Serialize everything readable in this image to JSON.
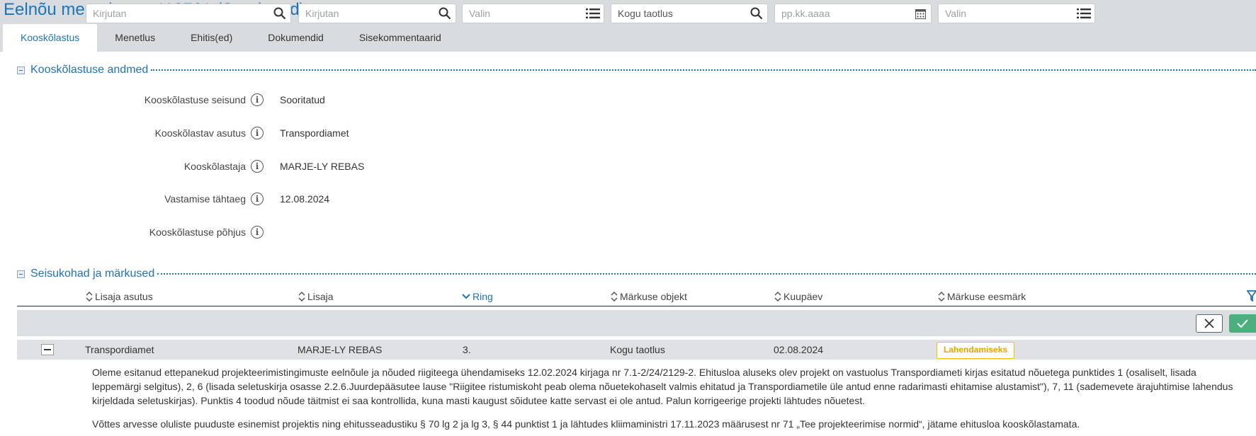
{
  "page": {
    "title": "Eelnõu menetlus nr 419761 (Sooritatud)"
  },
  "tabs": [
    {
      "label": "Kooskõlastus",
      "active": true
    },
    {
      "label": "Menetlus",
      "active": false
    },
    {
      "label": "Ehitis(ed)",
      "active": false
    },
    {
      "label": "Dokumendid",
      "active": false
    },
    {
      "label": "Sisekommentaarid",
      "active": false
    }
  ],
  "approval": {
    "section_title": "Kooskõlastuse andmed",
    "fields": [
      {
        "label": "Kooskõlastuse seisund",
        "value": "Sooritatud"
      },
      {
        "label": "Kooskõlastav asutus",
        "value": "Transpordiamet"
      },
      {
        "label": "Kooskõlastaja",
        "value": "MARJE-LY REBAS"
      },
      {
        "label": "Vastamise tähtaeg",
        "value": "12.08.2024"
      },
      {
        "label": "Kooskõlastuse põhjus",
        "value": ""
      }
    ]
  },
  "remarks": {
    "section_title": "Seisukohad ja märkused",
    "columns": [
      {
        "label": "Lisaja asutus",
        "sort": "none"
      },
      {
        "label": "Lisaja",
        "sort": "none"
      },
      {
        "label": "Ring",
        "sort": "desc"
      },
      {
        "label": "Märkuse objekt",
        "sort": "none"
      },
      {
        "label": "Kuupäev",
        "sort": "none"
      },
      {
        "label": "Märkuse eesmärk",
        "sort": "none"
      }
    ],
    "filters": {
      "lisaja_asutus": {
        "placeholder": "Kirjutan",
        "icon": "search-icon"
      },
      "lisaja": {
        "placeholder": "Kirjutan",
        "icon": "search-icon"
      },
      "ring": {
        "placeholder": "Valin",
        "icon": "list-icon"
      },
      "markuse_objekt": {
        "value": "Kogu taotlus",
        "icon": "search-icon"
      },
      "kuupaev": {
        "placeholder": "pp.kk.aaaa",
        "icon": "calendar-icon"
      },
      "markuse_eesmark": {
        "placeholder": "Valin",
        "icon": "list-icon"
      }
    },
    "rows": [
      {
        "lisaja_asutus": "Transpordiamet",
        "lisaja": "MARJE-LY REBAS",
        "ring": "3.",
        "markuse_objekt": "Kogu taotlus",
        "kuupaev": "02.08.2024",
        "markuse_eesmark": "Lahendamiseks",
        "text_lines_p1": [
          "Oleme esitanud ettepanekud projekteerimistingimuste eelnõule ja nõuded riigiteega ühendamiseks 12.02.2024 kirjaga nr 7.1-2/24/2129-2. Ehitusloa aluseks olev projekt on vastuolus Transpordiameti kirjas esitatud nõuetega punktides 1 (osaliselt, lisada",
          "leppemärgi selgitus), 2, 6 (lisada seletuskirja osasse 2.2.6.Juurdepääsutee lause \"Riigitee ristumiskoht peab olema nõuetekohaselt valmis ehitatud ja Transpordiametile üle antud enne radarimasti ehitamise alustamist\"), 7, 11 (sademevete ärajuhtimise lahendus",
          "kirjeldada seletuskirjas). Punktis 4 toodud nõude täitmist ei saa kontrollida, kuna masti kaugust sõidutee katte servast ei ole antud. Palun korrigeerige projekti lähtudes nõuetest."
        ],
        "text_p2": "Võttes arvesse oluliste puuduste esinemist projektis ning ehitusseadustiku § 70 lg 2 ja lg 3, § 44 punktist 1 ja lähtudes kliimaministri 17.11.2023 määrusest nr 71 „Tee projekteerimise normid“, jätame ehitusloa kooskõlastamata."
      }
    ]
  },
  "colors": {
    "accent": "#1f73b7",
    "badge_border": "#f5c300",
    "badge_text": "#e3a300",
    "confirm": "#4caf7d"
  }
}
